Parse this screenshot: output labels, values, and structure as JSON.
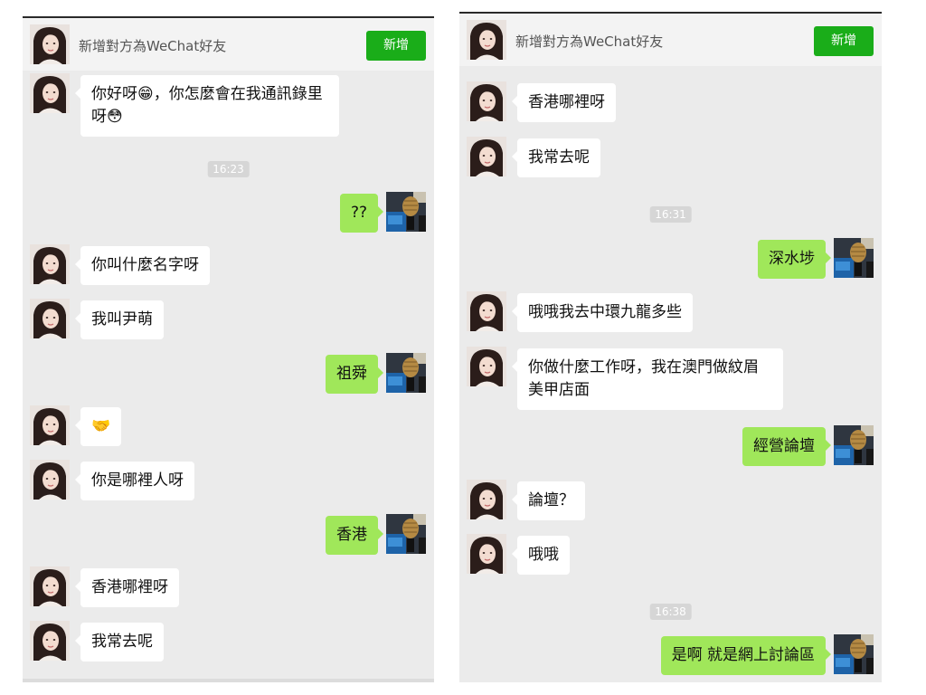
{
  "header": {
    "title": "新增對方為WeChat好友",
    "add_label": "新增"
  },
  "left_panel": {
    "messages": [
      {
        "side": "left",
        "text": "你好呀😁，你怎麼會在我通訊錄里呀😳"
      },
      {
        "type": "time",
        "text": "16:23"
      },
      {
        "side": "right",
        "text": "??"
      },
      {
        "side": "left",
        "text": "你叫什麼名字呀"
      },
      {
        "side": "left",
        "text": "我叫尹萌"
      },
      {
        "side": "right",
        "text": "祖舜"
      },
      {
        "side": "left",
        "text": "🤝"
      },
      {
        "side": "left",
        "text": "你是哪裡人呀"
      },
      {
        "side": "right",
        "text": "香港"
      },
      {
        "side": "left",
        "text": "香港哪裡呀"
      },
      {
        "side": "left",
        "text": "我常去呢"
      }
    ]
  },
  "right_panel": {
    "messages": [
      {
        "side": "left",
        "text": "香港哪裡呀"
      },
      {
        "side": "left",
        "text": "我常去呢"
      },
      {
        "type": "time",
        "text": "16:31"
      },
      {
        "side": "right",
        "text": "深水埗"
      },
      {
        "side": "left",
        "text": "哦哦我去中環九龍多些"
      },
      {
        "side": "left",
        "text": "你做什麼工作呀，我在澳門做紋眉美甲店面"
      },
      {
        "side": "right",
        "text": "經營論壇"
      },
      {
        "side": "left",
        "text": "論壇？"
      },
      {
        "side": "left",
        "text": "哦哦"
      },
      {
        "type": "time",
        "text": "16:38"
      },
      {
        "side": "right",
        "text": "是啊 就是網上討論區"
      }
    ]
  },
  "colors": {
    "accent_green": "#1aad19",
    "bubble_green": "#a0e75a",
    "chat_bg": "#ebebeb"
  },
  "icons": {
    "contact_avatar": "woman-portrait-avatar",
    "self_avatar": "microphone-photo-avatar"
  }
}
